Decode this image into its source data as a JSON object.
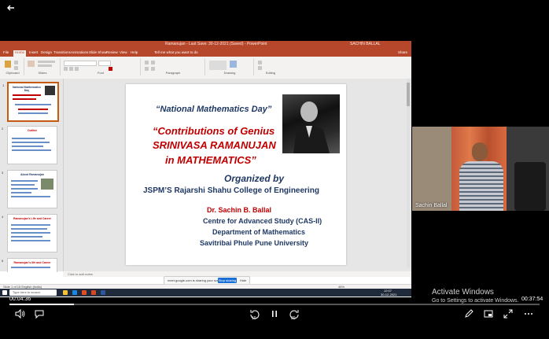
{
  "window": {
    "ppt_title": "Ramanujan - Last Save: 30-12-2021 (Saved) - PowerPoint",
    "ppt_user": "SACHIN BALLAL",
    "tabs": [
      "File",
      "Home",
      "Insert",
      "Design",
      "Transitions",
      "Animations",
      "Slide Show",
      "Review",
      "View",
      "Help",
      "Tell me what you want to do"
    ],
    "active_tab": "Home",
    "share_label": "Share",
    "ribbon_groups": [
      "Clipboard",
      "Slides",
      "Font",
      "Paragraph",
      "Drawing",
      "Editing"
    ],
    "notes_placeholder": "Click to add notes",
    "status_left": "Slide 1 of 15   English (India)",
    "status_zoom": "46%"
  },
  "thumbnails": [
    {
      "num": "1",
      "title": "National Mathematics Day"
    },
    {
      "num": "2",
      "title": "Outline"
    },
    {
      "num": "3",
      "title": "About Ramanujan"
    },
    {
      "num": "4",
      "title": "Ramanujan's Life and Career"
    },
    {
      "num": "5",
      "title": "Ramanujan's life and Career"
    }
  ],
  "slide": {
    "line1": "“National Mathematics Day”",
    "line2": "“Contributions of  Genius",
    "line3": "SRINIVASA RAMANUJAN",
    "line4": "in MATHEMATICS”",
    "line5": "Organized by",
    "line6": "JSPM’S Rajarshi Shahu College of Engineering",
    "line7": "Dr. Sachin B. Ballal",
    "line8": "Centre for Advanced Study (CAS-II)",
    "line9": "Department of Mathematics",
    "line10": "Savitribai Phule Pune University"
  },
  "share_bar": {
    "text": "meet.google.com is sharing your screen.",
    "stop": "Stop sharing",
    "hide": "Hide"
  },
  "taskbar": {
    "search": "Type here to search",
    "clock_time": "12:07",
    "clock_date": "30-12-2021"
  },
  "webcam": {
    "name": "Sachin Ballal"
  },
  "activate": {
    "title": "Activate Windows",
    "sub": "Go to Settings to activate Windows."
  },
  "player": {
    "current_time": "00:04:36",
    "total_time": "00:37:54",
    "progress": 0.121,
    "skip_back": "10",
    "skip_forward": "30"
  },
  "colors": {
    "ppt_accent": "#b7472a",
    "slide_blue": "#1f3864",
    "slide_red": "#c00000"
  }
}
